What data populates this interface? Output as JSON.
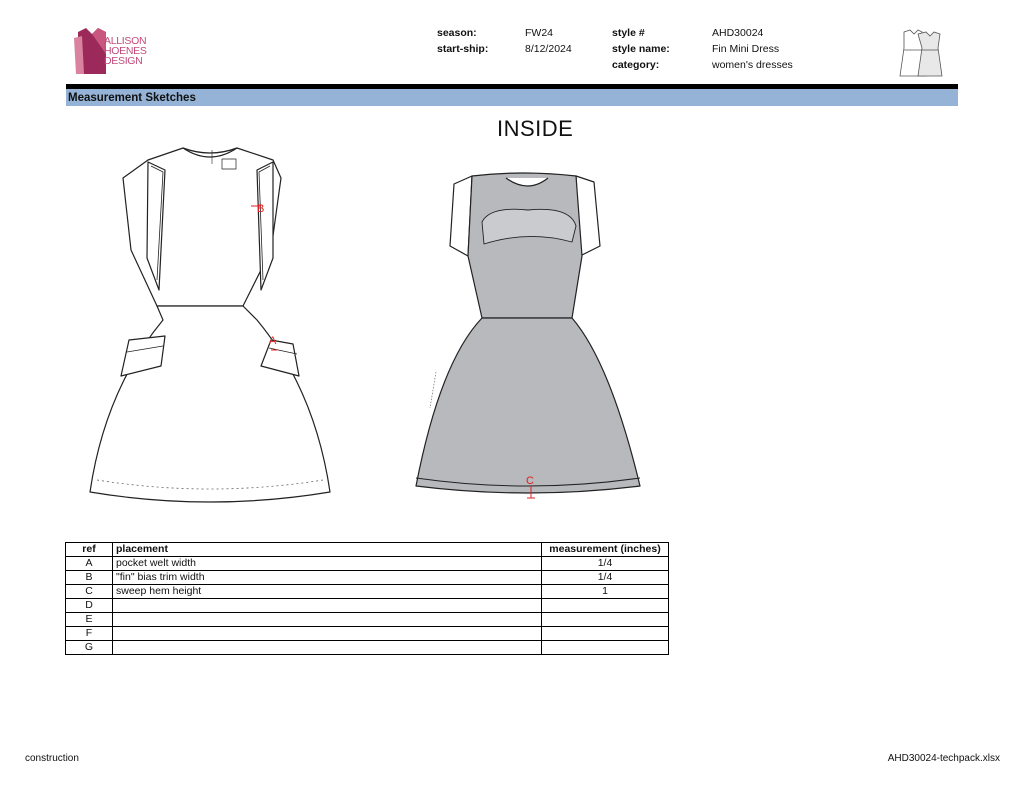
{
  "header": {
    "logo_text": [
      "ALLISON",
      "HOENES",
      "DESIGN"
    ],
    "season_label": "season:",
    "season": "FW24",
    "start_ship_label": "start-ship:",
    "start_ship": "8/12/2024",
    "style_no_label": "style #",
    "style_no": "AHD30024",
    "style_name_label": "style name:",
    "style_name": "Fin Mini Dress",
    "category_label": "category:",
    "category": "women's dresses"
  },
  "section_title": "Measurement Sketches",
  "view_title": "INSIDE",
  "sketch_markers": {
    "a": "A",
    "b": "B",
    "c": "C"
  },
  "table": {
    "headers": [
      "ref",
      "placement",
      "measurement (inches)"
    ],
    "rows": [
      {
        "ref": "A",
        "placement": "pocket welt width",
        "measurement": "1/4"
      },
      {
        "ref": "B",
        "placement": "\"fin\" bias trim width",
        "measurement": "1/4"
      },
      {
        "ref": "C",
        "placement": "sweep hem height",
        "measurement": "1"
      },
      {
        "ref": "D",
        "placement": "",
        "measurement": ""
      },
      {
        "ref": "E",
        "placement": "",
        "measurement": ""
      },
      {
        "ref": "F",
        "placement": "",
        "measurement": ""
      },
      {
        "ref": "G",
        "placement": "",
        "measurement": ""
      }
    ]
  },
  "footer": {
    "left": "construction",
    "right": "AHD30024-techpack.xlsx"
  },
  "colors": {
    "section_bar": "#95b3d7",
    "marker_red": "#e02020",
    "inside_fill": "#b7b9bc",
    "logo_magenta": "#9b2a5a"
  }
}
